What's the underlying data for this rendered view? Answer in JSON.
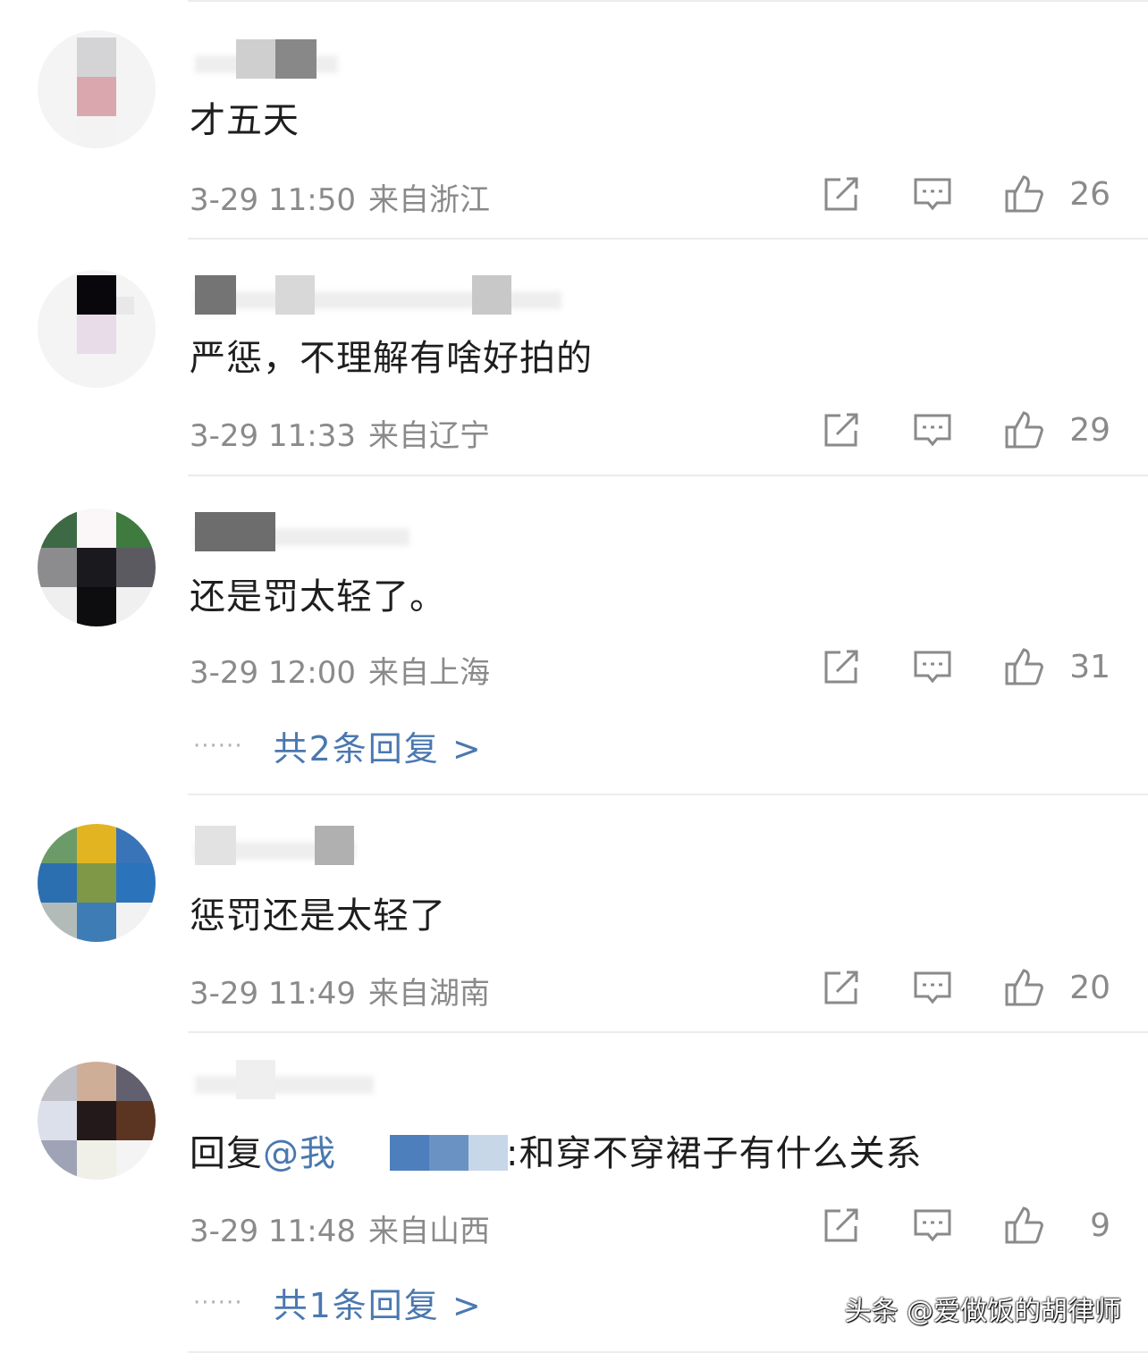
{
  "comments": [
    {
      "text": "才五天",
      "time": "3-29 11:50",
      "location": "来自浙江",
      "likes": "26"
    },
    {
      "text": "严惩，不理解有啥好拍的",
      "time": "3-29 11:33",
      "location": "来自辽宁",
      "likes": "29"
    },
    {
      "text": "还是罚太轻了。",
      "time": "3-29 12:00",
      "location": "来自上海",
      "likes": "31",
      "replies": "共2条回复 >"
    },
    {
      "text": "惩罚还是太轻了",
      "time": "3-29 11:49",
      "location": "来自湖南",
      "likes": "20"
    },
    {
      "reply_prefix": "回复",
      "mention": "@我",
      "text": ":和穿不穿裙子有什么关系",
      "time": "3-29 11:48",
      "location": "来自山西",
      "likes": "9",
      "replies": "共1条回复 >"
    }
  ],
  "dots": "······",
  "watermark": "头条 @爱做饭的胡律师"
}
